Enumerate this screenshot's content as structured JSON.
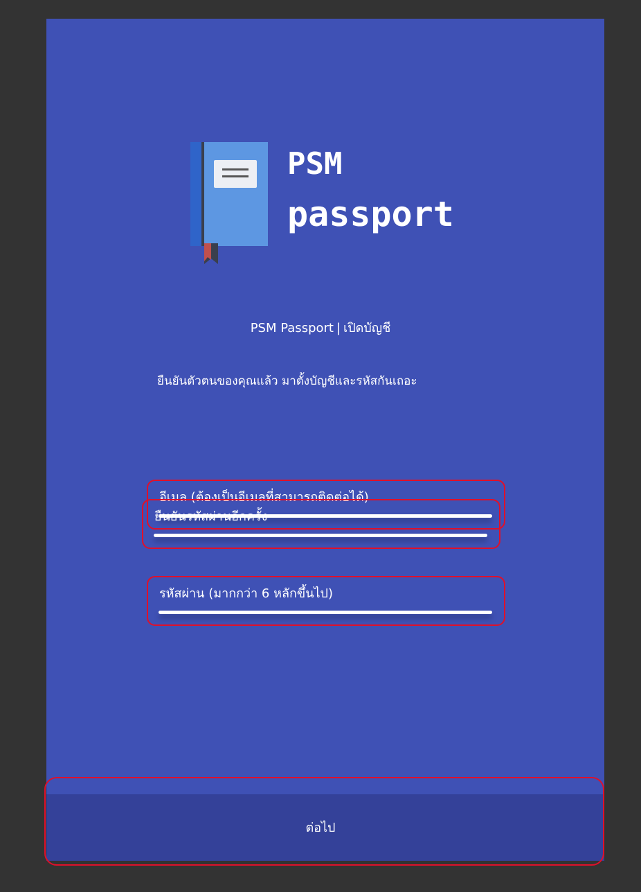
{
  "logo": {
    "icon": "notebook-icon",
    "line1": "PSM",
    "line2": "passport"
  },
  "header": {
    "app_name": "PSM Passport",
    "separator": "|",
    "page_title": "เปิดบัญชี"
  },
  "description": "ยืนยันตัวตนของคุณแล้ว มาตั้งบัญชีและรหัสกันเถอะ",
  "form": {
    "email_label": "อีเมล (ต้องเป็นอีเมลที่สามารถติดต่อได้)",
    "password_label": "รหัสผ่าน (มากกว่า 6 หลักขึ้นไป)",
    "confirm_label": "ยืนยันรหัสผ่านอีกครั้ง"
  },
  "footer": {
    "next_label": "ต่อไป"
  },
  "colors": {
    "page_background": "#333333",
    "card_background": "#3f51b5",
    "footer_background": "#344199",
    "highlight": "#e0102a"
  }
}
